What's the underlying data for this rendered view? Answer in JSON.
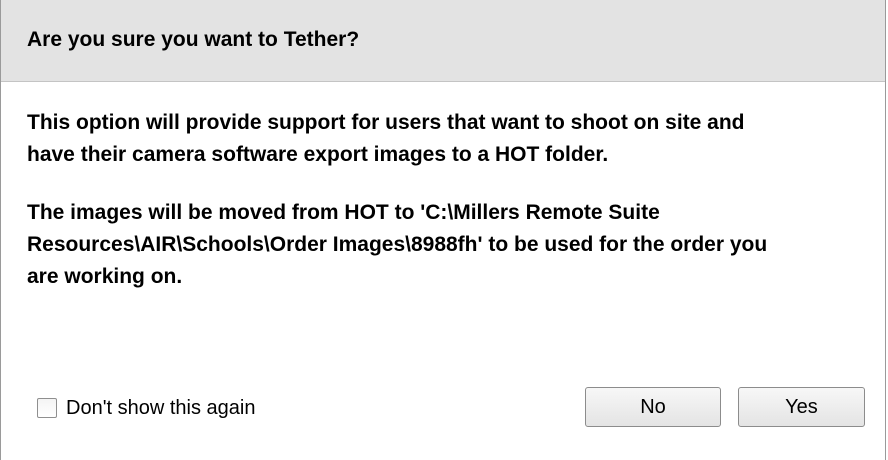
{
  "dialog": {
    "title": "Are you sure you want to Tether?",
    "paragraph1_line1": "This option will provide support for users that want to shoot on site and",
    "paragraph1_line2": "have their camera software export images to a HOT folder.",
    "paragraph2_line1": "The images will be moved from HOT to 'C:\\Millers Remote Suite",
    "paragraph2_line2": "Resources\\AIR\\Schools\\Order Images\\8988fh' to be used for the order you",
    "paragraph2_line3": "are working on."
  },
  "footer": {
    "dont_show_label": "Don't show this again",
    "dont_show_checked": false,
    "no_label": "No",
    "yes_label": "Yes"
  }
}
